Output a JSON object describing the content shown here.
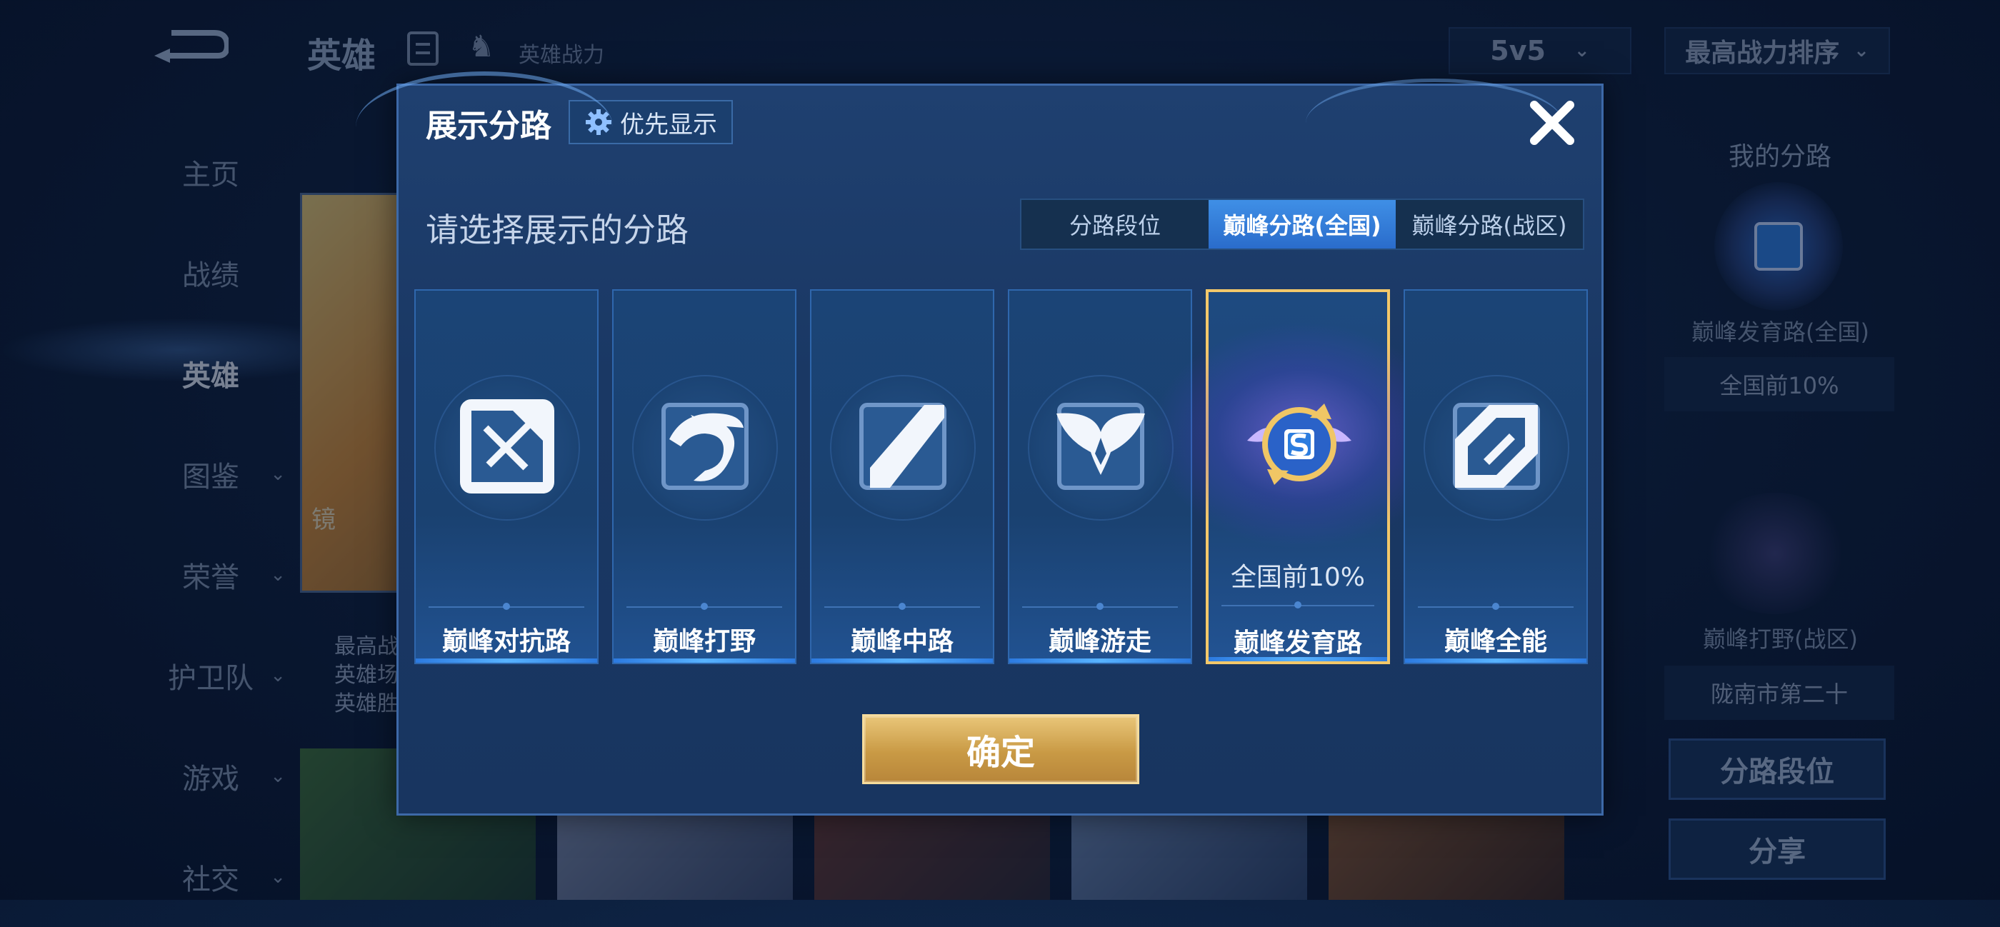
{
  "app": {
    "top_title": "英雄",
    "power_label": "英雄战力",
    "mode_select": "5v5",
    "sort_select": "最高战力排序"
  },
  "side_nav": [
    {
      "label": "主页"
    },
    {
      "label": "战绩"
    },
    {
      "label": "英雄",
      "active": true
    },
    {
      "label": "图鉴"
    },
    {
      "label": "荣誉"
    },
    {
      "label": "护卫队"
    },
    {
      "label": "游戏"
    },
    {
      "label": "社交"
    }
  ],
  "hero_card": {
    "name": "镜",
    "stats": [
      "最高战",
      "英雄场",
      "英雄胜"
    ]
  },
  "right_panel": {
    "title": "我的分路",
    "lane1_label": "巅峰发育路(全国)",
    "lane1_rank": "全国前10%",
    "lane2_label": "巅峰打野(战区)",
    "lane2_rank": "陇南市第二十",
    "btn_lane_rank": "分路段位",
    "btn_share": "分享"
  },
  "modal": {
    "title": "展示分路",
    "priority_label": "优先显示",
    "prompt": "请选择展示的分路",
    "tabs": [
      {
        "label": "分路段位"
      },
      {
        "label": "巅峰分路(全国)",
        "active": true
      },
      {
        "label": "巅峰分路(战区)"
      }
    ],
    "roles": [
      {
        "name": "巅峰对抗路",
        "icon": "sword-cross-icon"
      },
      {
        "name": "巅峰打野",
        "icon": "dragon-icon"
      },
      {
        "name": "巅峰中路",
        "icon": "staff-icon"
      },
      {
        "name": "巅峰游走",
        "icon": "wings-icon"
      },
      {
        "name": "巅峰发育路",
        "icon": "marksman-emblem-icon",
        "selected": true,
        "rank": "全国前10%"
      },
      {
        "name": "巅峰全能",
        "icon": "all-round-icon"
      }
    ],
    "confirm_label": "确定"
  },
  "colors": {
    "accent_gold": "#f3c86a",
    "active_tab": "#3f8fe6",
    "modal_bg": "#1a3864"
  }
}
